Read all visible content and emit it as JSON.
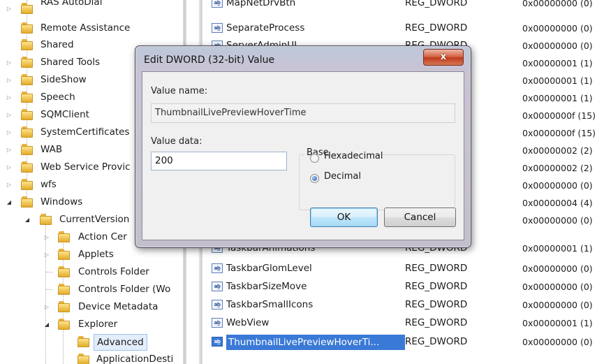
{
  "tree": {
    "items": [
      {
        "label": "RAS AutoDial"
      },
      {
        "label": "Remote Assistance"
      },
      {
        "label": "Shared"
      },
      {
        "label": "Shared Tools"
      },
      {
        "label": "SideShow"
      },
      {
        "label": "Speech"
      },
      {
        "label": "SQMClient"
      },
      {
        "label": "SystemCertificates"
      },
      {
        "label": "WAB"
      },
      {
        "label": "Web Service Provic"
      },
      {
        "label": "wfs"
      },
      {
        "label": "Windows"
      },
      {
        "label": "CurrentVersion"
      },
      {
        "label": "Action Cer"
      },
      {
        "label": "Applets"
      },
      {
        "label": "Controls Folder"
      },
      {
        "label": "Controls Folder (Wo"
      },
      {
        "label": "Device Metadata"
      },
      {
        "label": "Explorer"
      },
      {
        "label": "Advanced"
      },
      {
        "label": "ApplicationDesti"
      }
    ]
  },
  "values": {
    "rows": [
      {
        "name": "MapNetDrvBtn",
        "type": "REG_DWORD",
        "data": "0x00000000 (0)"
      },
      {
        "name": "SeparateProcess",
        "type": "REG_DWORD",
        "data": "0x00000000 (0)"
      },
      {
        "name": "ServerAdminUI",
        "type": "REG_DWORD",
        "data": "0x00000000 (0)"
      },
      {
        "name": "",
        "type": "",
        "data": "0x00000001 (1)"
      },
      {
        "name": "",
        "type": "",
        "data": "0x00000001 (1)"
      },
      {
        "name": "",
        "type": "",
        "data": "0x00000001 (1)"
      },
      {
        "name": "",
        "type": "",
        "data": "0x0000000f (15)"
      },
      {
        "name": "",
        "type": "",
        "data": "0x0000000f (15)"
      },
      {
        "name": "",
        "type": "",
        "data": "0x00000002 (2)"
      },
      {
        "name": "",
        "type": "",
        "data": "0x00000002 (2)"
      },
      {
        "name": "",
        "type": "",
        "data": "0x00000000 (0)"
      },
      {
        "name": "",
        "type": "",
        "data": "0x00000004 (4)"
      },
      {
        "name": "",
        "type": "",
        "data": "0x00000000 (0)"
      },
      {
        "name": "TaskbarAnimations",
        "type": "REG_DWORD",
        "data": "0x00000001 (1)"
      },
      {
        "name": "TaskbarGlomLevel",
        "type": "REG_DWORD",
        "data": "0x00000000 (0)"
      },
      {
        "name": "TaskbarSizeMove",
        "type": "REG_DWORD",
        "data": "0x00000000 (0)"
      },
      {
        "name": "TaskbarSmallIcons",
        "type": "REG_DWORD",
        "data": "0x00000000 (0)"
      },
      {
        "name": "WebView",
        "type": "REG_DWORD",
        "data": "0x00000001 (1)"
      },
      {
        "name": "ThumbnailLivePreviewHoverTi...",
        "type": "REG_DWORD",
        "data": "0x00000000 (0)"
      }
    ],
    "icon_glyph": "ab̲"
  },
  "dialog": {
    "title": "Edit DWORD (32-bit) Value",
    "close_label": "x",
    "value_name_label": "Value name:",
    "value_name": "ThumbnailLivePreviewHoverTime",
    "value_data_label": "Value data:",
    "value_data": "200",
    "base_label": "Base",
    "hex_label": "Hexadecimal",
    "dec_label": "Decimal",
    "selected_base": "Decimal",
    "ok_label": "OK",
    "cancel_label": "Cancel"
  },
  "colors": {
    "selection": "#3a79d6",
    "dialog_frame": "#c4bfcd",
    "close_button": "#c9482a"
  }
}
